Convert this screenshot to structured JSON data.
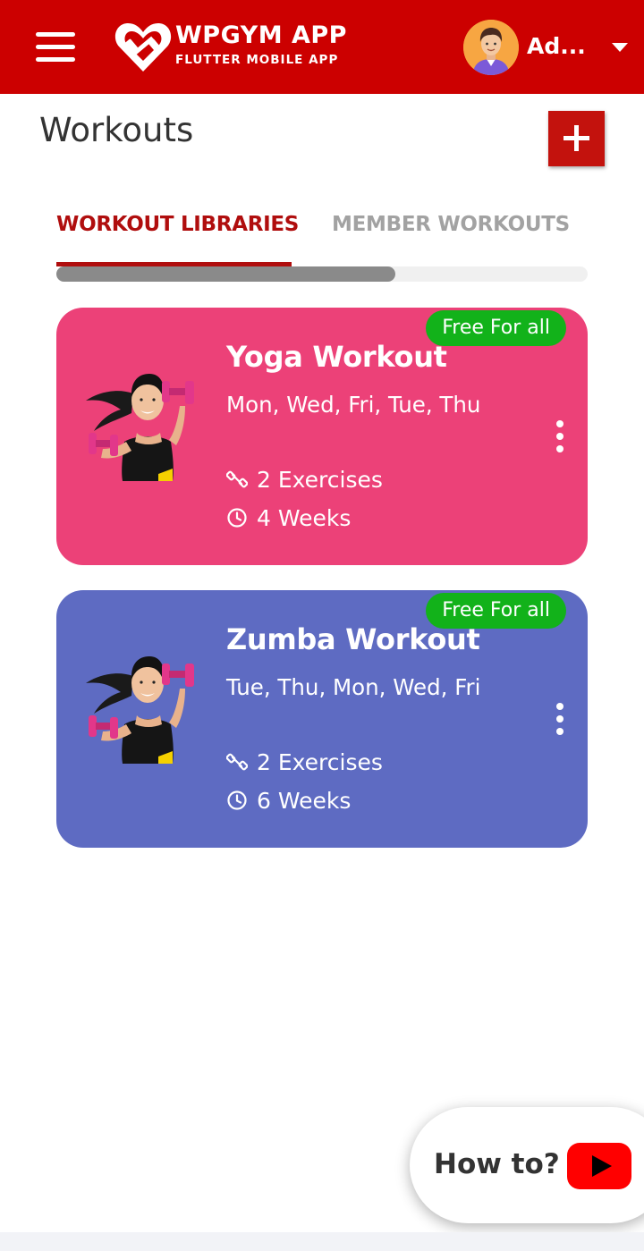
{
  "header": {
    "brand_title": "WPGYM APP",
    "brand_subtitle": "FLUTTER MOBILE APP",
    "user_name": "Ad...",
    "bar_color": "#cc0000",
    "menu_icon": "hamburger-menu-icon",
    "logo_icon": "heart-dumbbell-logo"
  },
  "page": {
    "title": "Workouts",
    "add_icon": "plus-icon"
  },
  "tabs": [
    {
      "label": "WORKOUT LIBRARIES",
      "active": true
    },
    {
      "label": "MEMBER WORKOUTS",
      "active": false
    }
  ],
  "workouts": [
    {
      "badge": "Free For all",
      "title": "Yoga Workout",
      "days": "Mon, Wed, Fri, Tue, Thu",
      "exercises": "2 Exercises",
      "weeks": "4 Weeks",
      "color": "#ec4178"
    },
    {
      "badge": "Free For all",
      "title": "Zumba Workout",
      "days": "Tue, Thu, Mon, Wed, Fri",
      "exercises": "2 Exercises",
      "weeks": "6 Weeks",
      "color": "#5e6bc2"
    }
  ],
  "help": {
    "label": "How to?",
    "icon": "youtube-play-icon"
  },
  "colors": {
    "accent": "#cc0000",
    "badge_green": "#12b21a",
    "active_tab": "#b00e0e",
    "inactive_tab": "#a2a2a2"
  }
}
